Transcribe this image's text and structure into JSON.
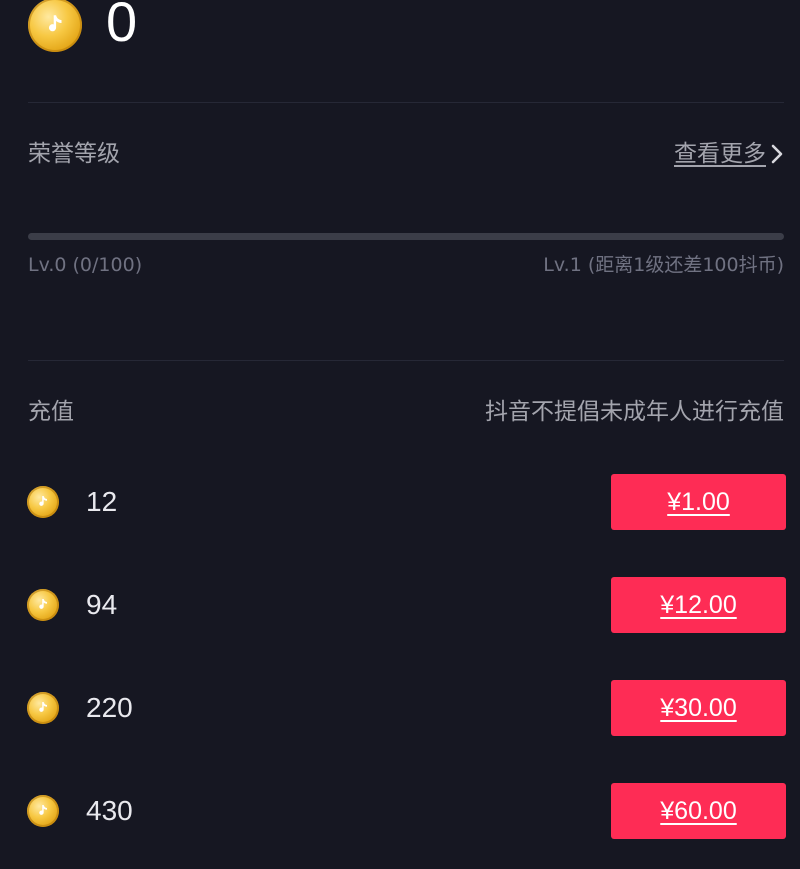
{
  "balance": {
    "value": "0",
    "icon": "douyin-coin-icon"
  },
  "honor": {
    "title": "荣誉等级",
    "see_more": "查看更多",
    "progress": 0,
    "current_level": "Lv.0 (0/100)",
    "next_level": "Lv.1 (距离1级还差100抖币)"
  },
  "recharge": {
    "title": "充值",
    "notice": "抖音不提倡未成年人进行充值",
    "packages": [
      {
        "coins": "12",
        "price": "¥1.00"
      },
      {
        "coins": "94",
        "price": "¥12.00"
      },
      {
        "coins": "220",
        "price": "¥30.00"
      },
      {
        "coins": "430",
        "price": "¥60.00"
      }
    ]
  },
  "colors": {
    "background": "#161722",
    "accent": "#fe2c55",
    "coin": "#f7c843",
    "muted_text": "#a3a4ad"
  }
}
